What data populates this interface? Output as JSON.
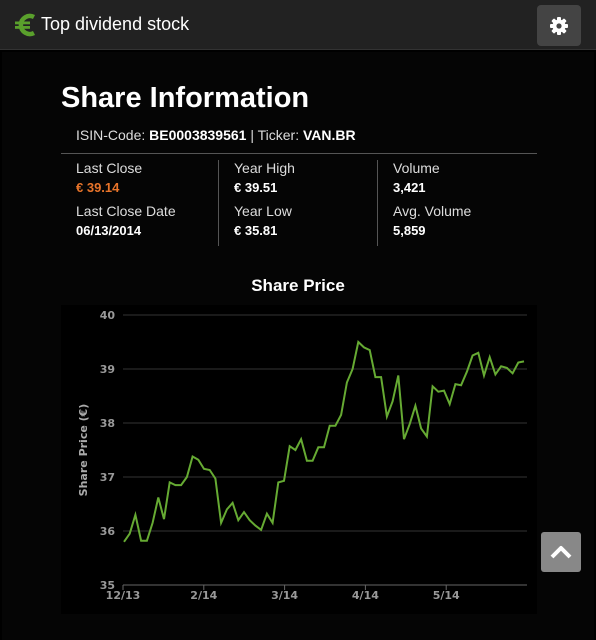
{
  "header": {
    "title": "Top dividend stock",
    "logo_icon": "euro-icon",
    "settings_icon": "gear-icon"
  },
  "info": {
    "title": "Share Information",
    "isin_label": "ISIN-Code:",
    "isin": "BE0003839561",
    "ticker_label": "| Ticker:",
    "ticker": "VAN.BR"
  },
  "stats": {
    "last_close_label": "Last Close",
    "last_close": "€ 39.14",
    "last_close_date_label": "Last Close Date",
    "last_close_date": "06/13/2014",
    "year_high_label": "Year High",
    "year_high": "€ 39.51",
    "year_low_label": "Year Low",
    "year_low": "€ 35.81",
    "volume_label": "Volume",
    "volume": "3,421",
    "avg_volume_label": "Avg. Volume",
    "avg_volume": "5,859"
  },
  "colors": {
    "accent_orange": "#e8742a",
    "line_green": "#66aa33",
    "logo_green": "#5aa02c"
  },
  "chart_data": {
    "type": "line",
    "title": "Share Price",
    "xlabel": "",
    "ylabel": "Share Price (€)",
    "ylim": [
      35,
      40
    ],
    "yticks": [
      35,
      36,
      37,
      38,
      39,
      40
    ],
    "xtick_labels": [
      "12/13",
      "2/14",
      "3/14",
      "4/14",
      "5/14"
    ],
    "grid": true,
    "series": [
      {
        "values": [
          35.8,
          35.95,
          36.3,
          35.82,
          35.82,
          36.15,
          36.62,
          36.22,
          36.9,
          36.85,
          36.85,
          37.0,
          37.38,
          37.32,
          37.15,
          37.13,
          36.97,
          36.15,
          36.4,
          36.52,
          36.2,
          36.35,
          36.2,
          36.1,
          36.02,
          36.32,
          36.15,
          36.9,
          36.93,
          37.57,
          37.5,
          37.7,
          37.3,
          37.3,
          37.55,
          37.55,
          37.95,
          37.95,
          38.15,
          38.75,
          39.0,
          39.5,
          39.4,
          39.35,
          38.85,
          38.85,
          38.12,
          38.4,
          38.88,
          37.7,
          37.98,
          38.32,
          37.9,
          37.75,
          38.68,
          38.58,
          38.6,
          38.35,
          38.72,
          38.7,
          38.95,
          39.25,
          39.3,
          38.88,
          39.22,
          38.9,
          39.05,
          39.02,
          38.92,
          39.12,
          39.14
        ]
      }
    ]
  }
}
